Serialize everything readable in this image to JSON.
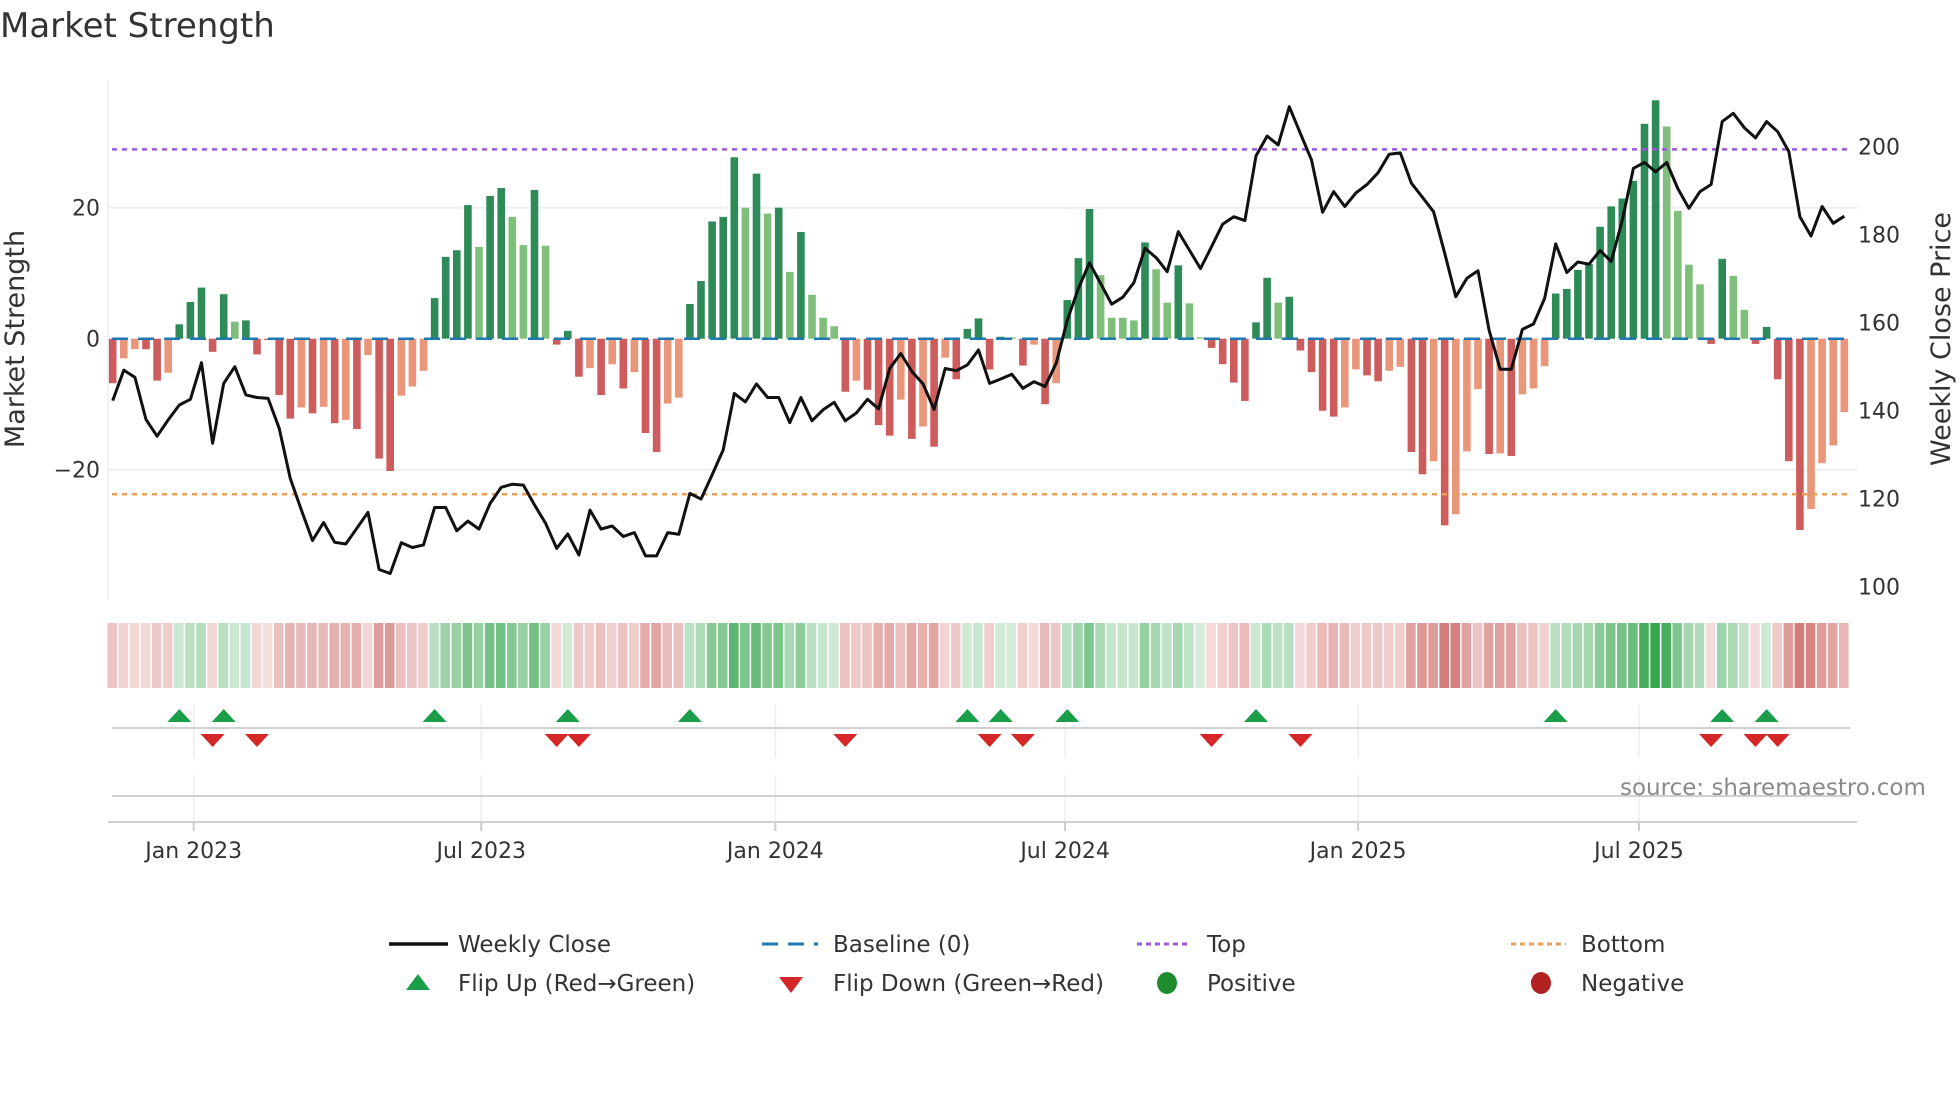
{
  "title": "Market Strength",
  "source": "source: sharemaestro.com",
  "colors": {
    "green_dark": "#2e8b57",
    "green_light": "#7fbf7b",
    "red_dark": "#cd5c5c",
    "red_light": "#e9967a",
    "baseline": "#1f77b4",
    "top": "#9b59d6",
    "bottom": "#e8a05a",
    "flip_up": "#1a9e4a",
    "flip_down": "#d62728",
    "positive": "#1e8c2e",
    "negative": "#b22222",
    "price_line": "#111111"
  },
  "legend": {
    "weekly_close": "Weekly Close",
    "baseline": "Baseline (0)",
    "top": "Top",
    "bottom": "Bottom",
    "flip_up": "Flip Up (Red→Green)",
    "flip_down": "Flip Down (Green→Red)",
    "positive": "Positive",
    "negative": "Negative"
  },
  "chart_data": {
    "type": "bar+line",
    "title": "Market Strength",
    "ylabel": "Market Strength",
    "y2label": "Weekly Close Price",
    "ylim": [
      -40,
      38
    ],
    "y2lim": [
      97,
      215
    ],
    "yticks": [
      20,
      0,
      -20
    ],
    "yticklabels": [
      "20",
      "0",
      "−20"
    ],
    "y2ticks": [
      200,
      180,
      160,
      140,
      120,
      100
    ],
    "xticks": [
      {
        "label": "Jan 2023",
        "week": 7.3
      },
      {
        "label": "Jul 2023",
        "week": 33.2
      },
      {
        "label": "Jan 2024",
        "week": 59.7
      },
      {
        "label": "Jul 2024",
        "week": 85.8
      },
      {
        "label": "Jan 2025",
        "week": 112.2
      },
      {
        "label": "Jul 2025",
        "week": 137.5
      }
    ],
    "baseline": 0,
    "top_price": 199.4,
    "bottom_price": 121,
    "strength": [
      -6.8,
      -3,
      -1.6,
      -1.6,
      -6.4,
      -5.2,
      2.2,
      5.6,
      7.8,
      -2,
      6.8,
      2.6,
      2.8,
      -2.4,
      -0.2,
      -8.6,
      -12.2,
      -10.5,
      -11.4,
      -10.4,
      -12.9,
      -12.4,
      -13.8,
      -2.5,
      -18.3,
      -20.2,
      -8.7,
      -7.3,
      -4.9,
      6.2,
      12.5,
      13.5,
      20.4,
      14,
      21.8,
      23,
      18.6,
      14.3,
      22.7,
      14.2,
      -0.9,
      1.2,
      -5.8,
      -4.5,
      -8.6,
      -3.9,
      -7.6,
      -5.1,
      -14.4,
      -17.3,
      -9.9,
      -9,
      5.3,
      8.8,
      17.9,
      18.6,
      27.7,
      20,
      25.2,
      19.1,
      20,
      10.2,
      16.3,
      6.7,
      3.2,
      1.9,
      -8.1,
      -6.4,
      -7.8,
      -13.2,
      -14.8,
      -9.3,
      -15.3,
      -13.4,
      -16.5,
      -2.9,
      -6.2,
      1.5,
      3.1,
      -4.7,
      0.3,
      0.2,
      -4.1,
      -0.9,
      -10,
      -6.8,
      5.9,
      12.3,
      19.8,
      9.7,
      3.2,
      3.2,
      2.8,
      14.7,
      10.6,
      5.5,
      11.2,
      5.4,
      0.2,
      -1.4,
      -3.9,
      -6.7,
      -9.5,
      2.5,
      9.3,
      5.5,
      6.4,
      -1.8,
      -5.1,
      -11,
      -11.9,
      -10.5,
      -4.7,
      -5.6,
      -6.5,
      -4.9,
      -4.3,
      -17.3,
      -20.7,
      -18.7,
      -28.5,
      -26.8,
      -17.2,
      -7.7,
      -17.6,
      -17.5,
      -17.9,
      -8.5,
      -7.6,
      -4.2,
      6.9,
      7.6,
      10.5,
      11.4,
      17.1,
      20.2,
      21.4,
      24.1,
      32.8,
      36.4,
      32.4,
      19.5,
      11.3,
      8.3,
      -0.8,
      12.2,
      9.6,
      4.4,
      -0.8,
      1.8,
      -6.2,
      -18.7,
      -29.2,
      -26,
      -19,
      -16.3,
      -11.2
    ],
    "strengthening": [
      1,
      0,
      0,
      1,
      1,
      0,
      1,
      1,
      1,
      1,
      1,
      0,
      1,
      1,
      1,
      1,
      1,
      0,
      1,
      0,
      1,
      0,
      1,
      0,
      1,
      1,
      0,
      0,
      0,
      1,
      1,
      1,
      1,
      0,
      1,
      1,
      0,
      0,
      1,
      0,
      1,
      1,
      1,
      0,
      1,
      0,
      1,
      0,
      1,
      1,
      0,
      0,
      1,
      1,
      1,
      1,
      1,
      0,
      1,
      0,
      1,
      0,
      1,
      0,
      0,
      0,
      1,
      0,
      1,
      1,
      1,
      0,
      1,
      0,
      1,
      0,
      1,
      1,
      1,
      1,
      1,
      0,
      1,
      0,
      1,
      0,
      1,
      1,
      1,
      0,
      0,
      0,
      0,
      1,
      0,
      0,
      1,
      0,
      0,
      1,
      1,
      1,
      1,
      1,
      1,
      0,
      1,
      1,
      1,
      1,
      1,
      0,
      0,
      1,
      1,
      0,
      0,
      1,
      1,
      0,
      1,
      0,
      0,
      0,
      1,
      0,
      1,
      0,
      0,
      0,
      1,
      1,
      1,
      1,
      1,
      1,
      1,
      1,
      1,
      1,
      0,
      0,
      0,
      0,
      1,
      1,
      0,
      0,
      1,
      1,
      1,
      1,
      1,
      0,
      0,
      0,
      0
    ],
    "weekly_close": [
      142.3,
      149.2,
      147.6,
      138.0,
      134.2,
      137.9,
      141.3,
      142.6,
      150.9,
      132.6,
      146.2,
      150.0,
      143.6,
      143.0,
      142.8,
      136.0,
      124.6,
      117.4,
      110.5,
      114.6,
      110.1,
      109.7,
      113.3,
      116.9,
      103.9,
      103.0,
      110.0,
      108.9,
      109.5,
      118.0,
      118.0,
      112.7,
      114.9,
      113.1,
      118.9,
      122.6,
      123.3,
      123.1,
      118.6,
      114.4,
      108.7,
      112.0,
      107.2,
      117.4,
      113.1,
      113.8,
      111.4,
      112.3,
      107.0,
      107.0,
      112.3,
      111.9,
      121.2,
      119.9,
      125.4,
      131.1,
      143.9,
      142.0,
      146.1,
      143.0,
      143.0,
      137.3,
      143.0,
      137.7,
      140.2,
      141.9,
      137.7,
      139.5,
      142.6,
      140.4,
      149.6,
      153.0,
      148.9,
      146.1,
      140.3,
      149.6,
      149.1,
      150.4,
      153.8,
      146.2,
      147.2,
      148.3,
      145.1,
      146.6,
      145.5,
      150.8,
      160.6,
      167.8,
      173.6,
      168.9,
      164.2,
      165.8,
      169.1,
      176.9,
      174.8,
      171.6,
      180.7,
      176.5,
      172.3,
      177.3,
      182.4,
      184.1,
      183.2,
      197.9,
      202.4,
      200.4,
      209.1,
      203.0,
      197.0,
      185.1,
      189.8,
      186.4,
      189.5,
      191.4,
      194.1,
      198.3,
      198.6,
      191.7,
      188.5,
      185.2,
      175.8,
      165.9,
      170.1,
      171.8,
      158.3,
      149.4,
      149.4,
      158.5,
      159.7,
      165.5,
      177.9,
      171.4,
      173.8,
      173.3,
      176.4,
      173.9,
      183.3,
      195.1,
      196.4,
      194.3,
      196.4,
      190.5,
      186.0,
      189.8,
      191.4,
      205.7,
      207.6,
      204.3,
      202.0,
      205.7,
      203.4,
      198.9,
      184.1,
      179.7,
      186.4,
      182.6,
      184.2
    ],
    "grid": true,
    "legend_position": "bottom"
  }
}
